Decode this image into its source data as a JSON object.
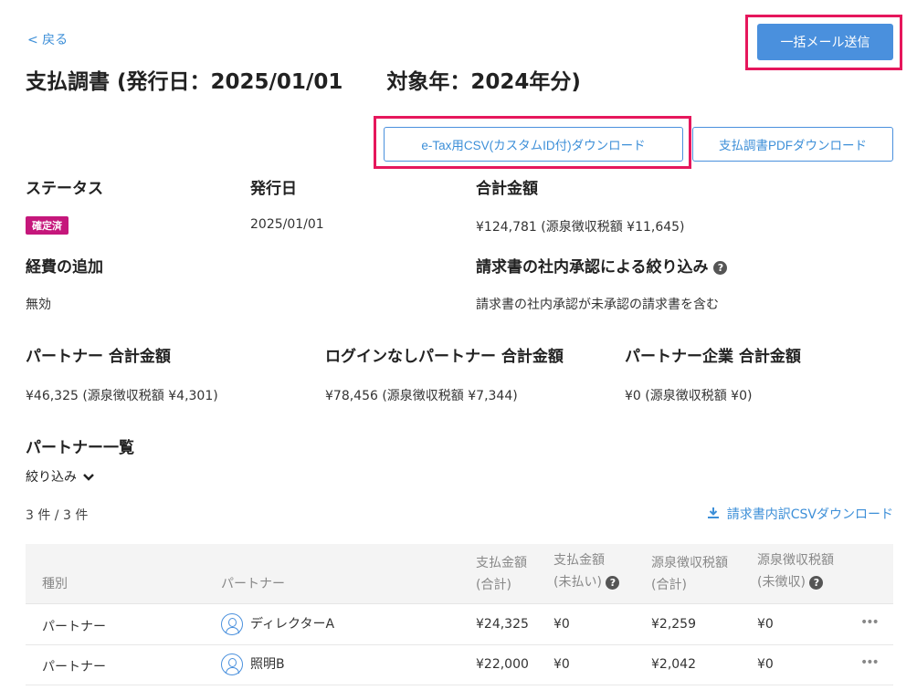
{
  "nav": {
    "back_label": "< 戻る"
  },
  "header": {
    "title_main": "支払調書 (発行日：2025/01/01",
    "title_target": "対象年：2024年分)",
    "bulk_mail_button": "一括メール送信"
  },
  "downloads": {
    "etax_csv_button": "e-Tax用CSV(カスタムID付)ダウンロード",
    "pdf_button": "支払調書PDFダウンロード"
  },
  "summary": {
    "status_label": "ステータス",
    "status_badge": "確定済",
    "issue_date_label": "発行日",
    "issue_date_value": "2025/01/01",
    "total_label": "合計金額",
    "total_value": "¥124,781 (源泉徴収税額 ¥11,645)",
    "expense_label": "経費の追加",
    "expense_value": "無効",
    "approval_label": "請求書の社内承認による絞り込み",
    "approval_value": "請求書の社内承認が未承認の請求書を含む"
  },
  "partner_totals": {
    "partner_label": "パートナー 合計金額",
    "partner_value": "¥46,325 (源泉徴収税額 ¥4,301)",
    "nologin_label": "ログインなしパートナー 合計金額",
    "nologin_value": "¥78,456 (源泉徴収税額 ¥7,344)",
    "company_label": "パートナー企業 合計金額",
    "company_value": "¥0 (源泉徴収税額 ¥0)"
  },
  "list": {
    "title": "パートナー一覧",
    "filter_label": "絞り込み",
    "count": "3 件 / 3 件",
    "invoice_csv_link": "請求書内訳CSVダウンロード",
    "columns": {
      "type": "種別",
      "partner": "パートナー",
      "paid_total_1": "支払金額",
      "paid_total_2": "(合計)",
      "paid_unpaid_1": "支払金額",
      "paid_unpaid_2": "(未払い)",
      "tax_total_1": "源泉徴収税額",
      "tax_total_2": "(合計)",
      "tax_uncollected_1": "源泉徴収税額",
      "tax_uncollected_2": "(未徴収)"
    },
    "rows": [
      {
        "type": "パートナー",
        "name": "ディレクターA",
        "paid_total": "¥24,325",
        "paid_unpaid": "¥0",
        "tax_total": "¥2,259",
        "tax_uncollected": "¥0"
      },
      {
        "type": "パートナー",
        "name": "照明B",
        "paid_total": "¥22,000",
        "paid_unpaid": "¥0",
        "tax_total": "¥2,042",
        "tax_uncollected": "¥0"
      }
    ]
  },
  "icons": {
    "help": "question-circle-icon",
    "chevron": "chevron-down-icon",
    "download": "download-icon",
    "avatar": "user-avatar-icon",
    "more": "more-dots-icon"
  },
  "colors": {
    "accent": "#4a90dd",
    "highlight": "#e6175c",
    "badge": "#c5177b"
  }
}
